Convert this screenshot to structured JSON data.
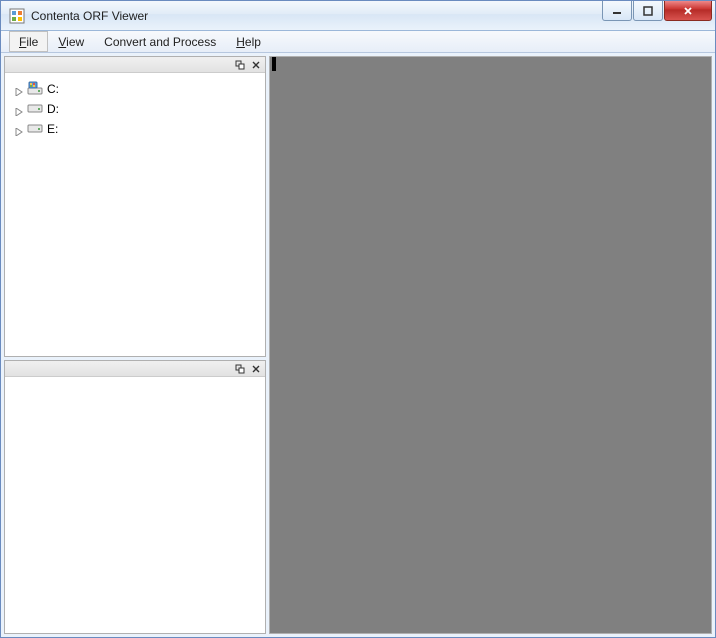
{
  "window": {
    "title": "Contenta ORF Viewer"
  },
  "menu": {
    "items": [
      {
        "label": "File",
        "mnemonic": "F"
      },
      {
        "label": "View",
        "mnemonic": "V"
      },
      {
        "label": "Convert and Process",
        "mnemonic": ""
      },
      {
        "label": "Help",
        "mnemonic": "H"
      }
    ]
  },
  "sidebar": {
    "drives": [
      {
        "label": "C:",
        "type": "system"
      },
      {
        "label": "D:",
        "type": "local"
      },
      {
        "label": "E:",
        "type": "local"
      }
    ]
  },
  "colors": {
    "mainViewBg": "#808080",
    "frameBorder": "#6a8bbf"
  }
}
